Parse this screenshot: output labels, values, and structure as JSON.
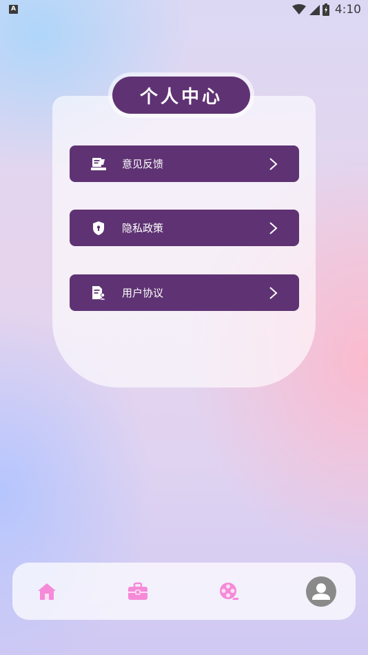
{
  "status_bar": {
    "notification_badge": "A",
    "time": "4:10"
  },
  "page": {
    "title": "个人中心"
  },
  "menu": {
    "items": [
      {
        "label": "意见反馈",
        "icon": "feedback-icon"
      },
      {
        "label": "隐私政策",
        "icon": "shield-icon"
      },
      {
        "label": "用户协议",
        "icon": "agreement-icon"
      }
    ]
  },
  "bottom_nav": {
    "tabs": [
      {
        "icon": "home-icon",
        "active": false
      },
      {
        "icon": "briefcase-icon",
        "active": false
      },
      {
        "icon": "film-reel-icon",
        "active": false
      },
      {
        "icon": "profile-icon",
        "active": true
      }
    ]
  },
  "colors": {
    "accent": "#5f3373",
    "nav_icon": "#f58ad8",
    "profile_circle": "#8a8a8a"
  }
}
